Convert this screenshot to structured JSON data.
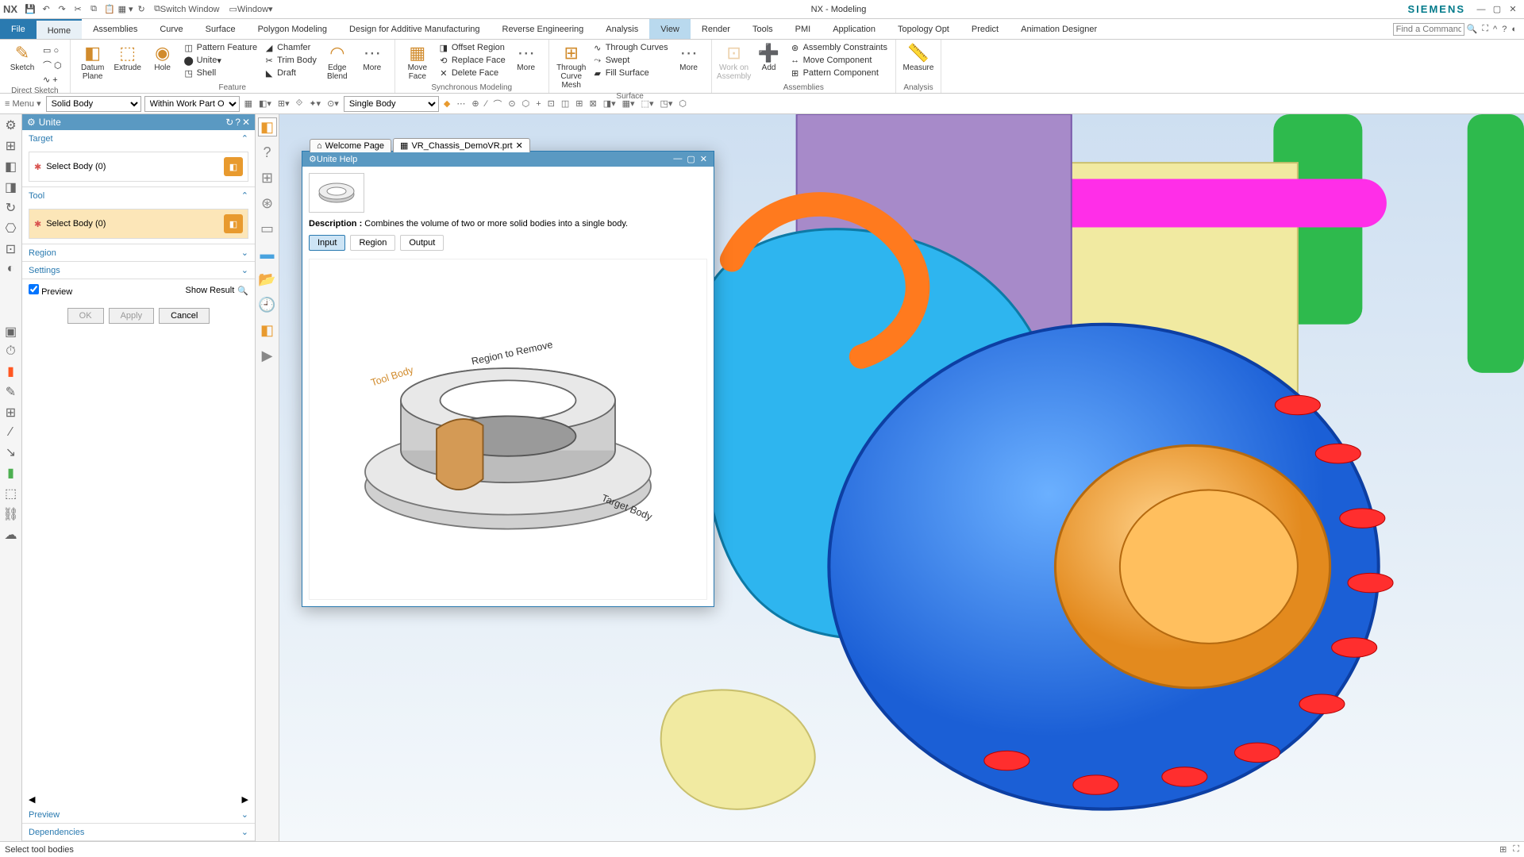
{
  "title_bar": {
    "app_label": "NX",
    "switch_window": "Switch Window",
    "window_label": "Window",
    "center_title": "NX - Modeling",
    "brand": "SIEMENS"
  },
  "ribbon_tabs": {
    "file": "File",
    "tabs": [
      "Home",
      "Assemblies",
      "Curve",
      "Surface",
      "Polygon Modeling",
      "Design for Additive Manufacturing",
      "Reverse Engineering",
      "Analysis",
      "View",
      "Render",
      "Tools",
      "PMI",
      "Application",
      "Topology Opt",
      "Predict",
      "Animation Designer"
    ],
    "active": "Home",
    "hover": "View",
    "find_placeholder": "Find a Command"
  },
  "ribbon": {
    "direct_sketch": {
      "sketch": "Sketch",
      "group": "Direct Sketch"
    },
    "feature": {
      "datum_plane": "Datum\nPlane",
      "extrude": "Extrude",
      "hole": "Hole",
      "pattern_feature": "Pattern Feature",
      "unite": "Unite",
      "shell": "Shell",
      "chamfer": "Chamfer",
      "trim_body": "Trim Body",
      "draft": "Draft",
      "edge_blend": "Edge\nBlend",
      "more": "More",
      "group": "Feature"
    },
    "sync": {
      "move_face": "Move\nFace",
      "offset_region": "Offset Region",
      "replace_face": "Replace Face",
      "delete_face": "Delete Face",
      "more": "More",
      "group": "Synchronous Modeling"
    },
    "surface": {
      "through_curve_mesh": "Through\nCurve Mesh",
      "through_curves": "Through Curves",
      "swept": "Swept",
      "fill_surface": "Fill Surface",
      "more": "More",
      "group": "Surface"
    },
    "assemblies": {
      "work_on_assembly": "Work on\nAssembly",
      "add": "Add",
      "assembly_constraints": "Assembly Constraints",
      "move_component": "Move Component",
      "pattern_component": "Pattern Component",
      "group": "Assemblies"
    },
    "analysis": {
      "measure": "Measure",
      "group": "Analysis"
    }
  },
  "selbar": {
    "menu": "Menu",
    "solid_body": "Solid Body",
    "scope": "Within Work Part Or",
    "single_body": "Single Body"
  },
  "doctabs": {
    "welcome": "Welcome Page",
    "active": "VR_Chassis_DemoVR.prt"
  },
  "unite_panel": {
    "title": "Unite",
    "target": "Target",
    "select_body_target": "Select Body (0)",
    "tool": "Tool",
    "select_body_tool": "Select Body (0)",
    "region": "Region",
    "settings": "Settings",
    "preview_cb": "Preview",
    "show_result": "Show Result",
    "ok": "OK",
    "apply": "Apply",
    "cancel": "Cancel",
    "preview": "Preview",
    "dependencies": "Dependencies"
  },
  "help": {
    "title": "Unite Help",
    "desc_label": "Description : ",
    "desc": "Combines the volume of two or more solid bodies into a single body.",
    "tabs": {
      "input": "Input",
      "region": "Region",
      "output": "Output"
    },
    "ann_tool": "Tool Body",
    "ann_region": "Region to Remove",
    "ann_target": "Target Body"
  },
  "status": {
    "message": "Select tool bodies"
  }
}
